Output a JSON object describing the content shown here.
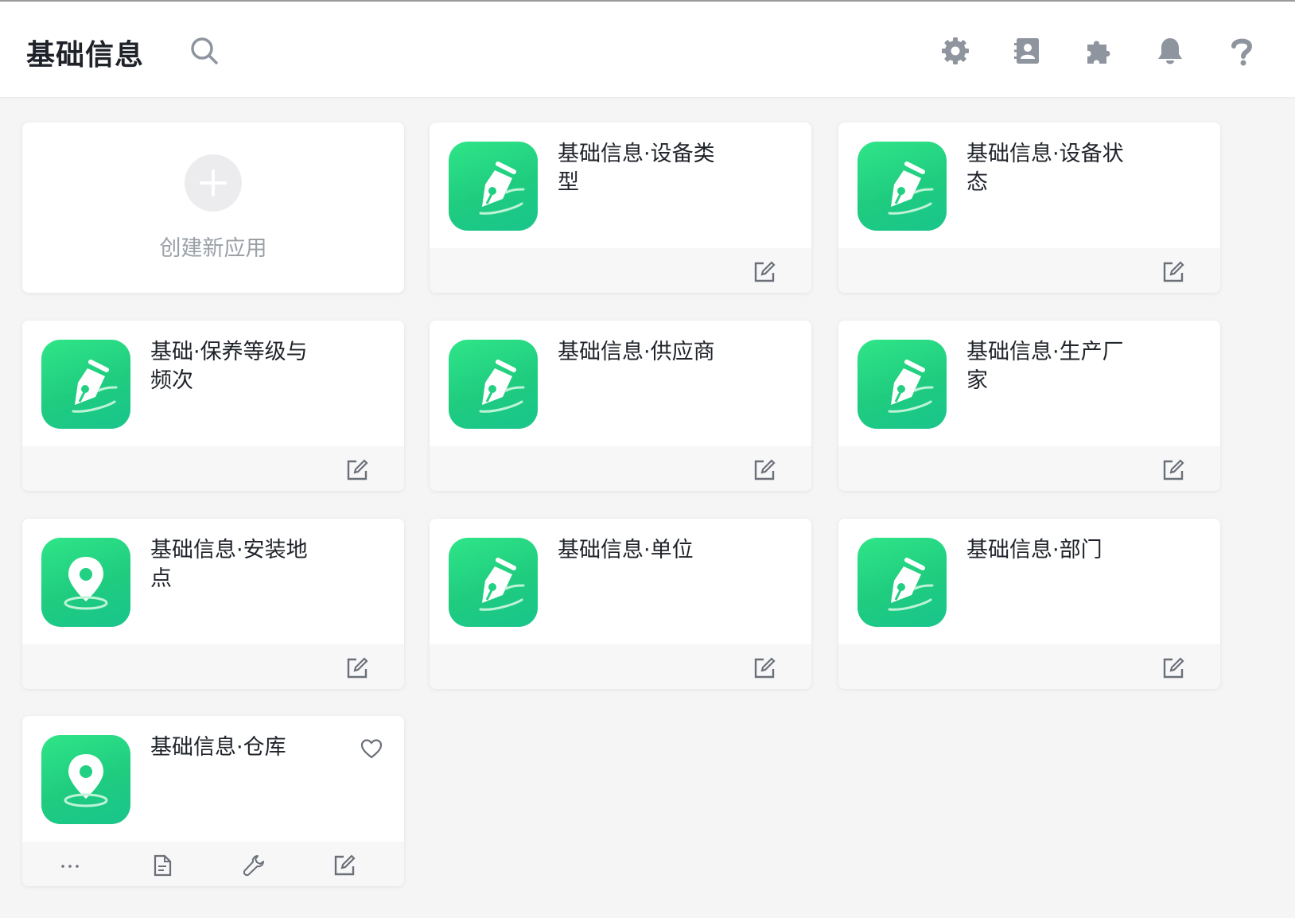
{
  "header": {
    "title": "基础信息",
    "icons": [
      "search-icon",
      "settings-icon",
      "contacts-icon",
      "plugin-icon",
      "notification-icon",
      "help-icon"
    ]
  },
  "create_card": {
    "label": "创建新应用",
    "icon": "plus-icon"
  },
  "apps": [
    {
      "title": "基础信息·设备类型",
      "icon": "pen-icon"
    },
    {
      "title": "基础信息·设备状态",
      "icon": "pen-icon"
    },
    {
      "title": "基础·保养等级与频次",
      "icon": "pen-icon"
    },
    {
      "title": "基础信息·供应商",
      "icon": "pen-icon"
    },
    {
      "title": "基础信息·生产厂家",
      "icon": "pen-icon"
    },
    {
      "title": "基础信息·安装地点",
      "icon": "location-icon"
    },
    {
      "title": "基础信息·单位",
      "icon": "pen-icon"
    },
    {
      "title": "基础信息·部门",
      "icon": "pen-icon"
    },
    {
      "title": "基础信息·仓库",
      "icon": "location-icon",
      "hovered": true
    }
  ],
  "hover_actions": [
    "more-icon",
    "document-icon",
    "wrench-icon",
    "edit-icon"
  ],
  "colors": {
    "icon_gradient_start": "#2fe588",
    "icon_gradient_end": "#19c58c",
    "header_icon": "#8f959e",
    "background": "#f5f5f6"
  }
}
